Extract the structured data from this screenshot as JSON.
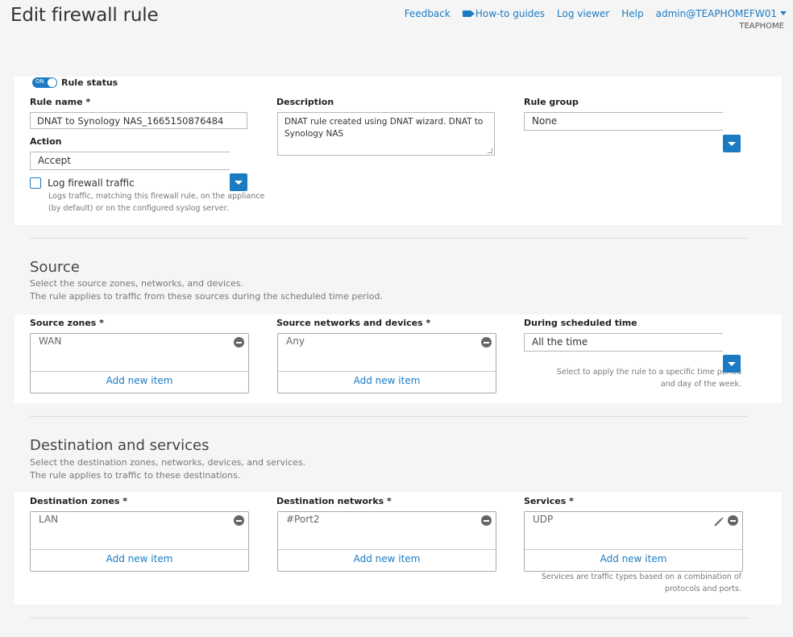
{
  "header": {
    "title": "Edit firewall rule",
    "nav": {
      "feedback": "Feedback",
      "howto": "How-to guides",
      "logviewer": "Log viewer",
      "help": "Help",
      "user": "admin@TEAPHOMEFW01"
    },
    "device": "TEAPHOME"
  },
  "rule": {
    "status_label": "Rule status",
    "toggle_text": "ON",
    "name_label": "Rule name *",
    "name_value": "DNAT to Synology NAS_1665150876484",
    "description_label": "Description",
    "description_value": "DNAT rule created using DNAT wizard. DNAT to Synology NAS",
    "group_label": "Rule group",
    "group_value": "None",
    "action_label": "Action",
    "action_value": "Accept",
    "log_label": "Log firewall traffic",
    "log_help": "Logs traffic, matching this firewall rule, on the appliance (by default) or on the configured syslog server."
  },
  "source": {
    "title": "Source",
    "subtitle1": "Select the source zones, networks, and devices.",
    "subtitle2": "The rule applies to traffic from these sources during the scheduled time period.",
    "zones_label": "Source zones *",
    "zones_item": "WAN",
    "networks_label": "Source networks and devices *",
    "networks_item": "Any",
    "schedule_label": "During scheduled time",
    "schedule_value": "All the time",
    "schedule_help": "Select to apply the rule to a specific time period and day of the week.",
    "add_label": "Add new item"
  },
  "destination": {
    "title": "Destination and services",
    "subtitle1": "Select the destination zones, networks, devices, and services.",
    "subtitle2": "The rule applies to traffic to these destinations.",
    "zones_label": "Destination zones *",
    "zones_item": "LAN",
    "networks_label": "Destination networks *",
    "networks_item": "#Port2",
    "services_label": "Services *",
    "services_item": "UDP",
    "services_help": "Services are traffic types based on a combination of protocols and ports.",
    "add_label": "Add new item"
  },
  "colors": {
    "accent": "#1b7bc2",
    "background": "#f5f5f5"
  }
}
